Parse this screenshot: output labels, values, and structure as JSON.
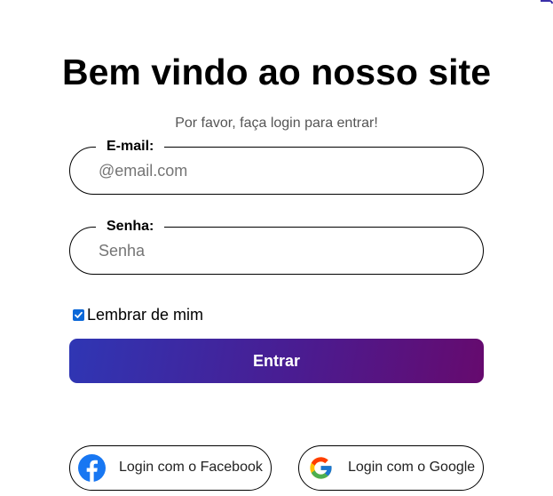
{
  "header": {
    "title": "Bem vindo ao nosso site",
    "subtitle": "Por favor, faça login para entrar!"
  },
  "form": {
    "email_label": "E-mail:",
    "email_placeholder": "@email.com",
    "email_value": "",
    "password_label": "Senha:",
    "password_placeholder": "Senha",
    "password_value": "",
    "remember_label": "Lembrar de mim",
    "remember_checked": true,
    "submit_label": "Entrar"
  },
  "social": {
    "facebook_label": "Login com o Facebook",
    "google_label": "Login com o Google"
  },
  "colors": {
    "button_gradient_start": "#2f36b4",
    "button_gradient_end": "#660a6e",
    "checkbox": "#0b68d8",
    "facebook": "#1877f2"
  },
  "icons": {
    "facebook": "facebook-icon",
    "google": "google-icon",
    "checkbox": "checkmark-icon"
  }
}
